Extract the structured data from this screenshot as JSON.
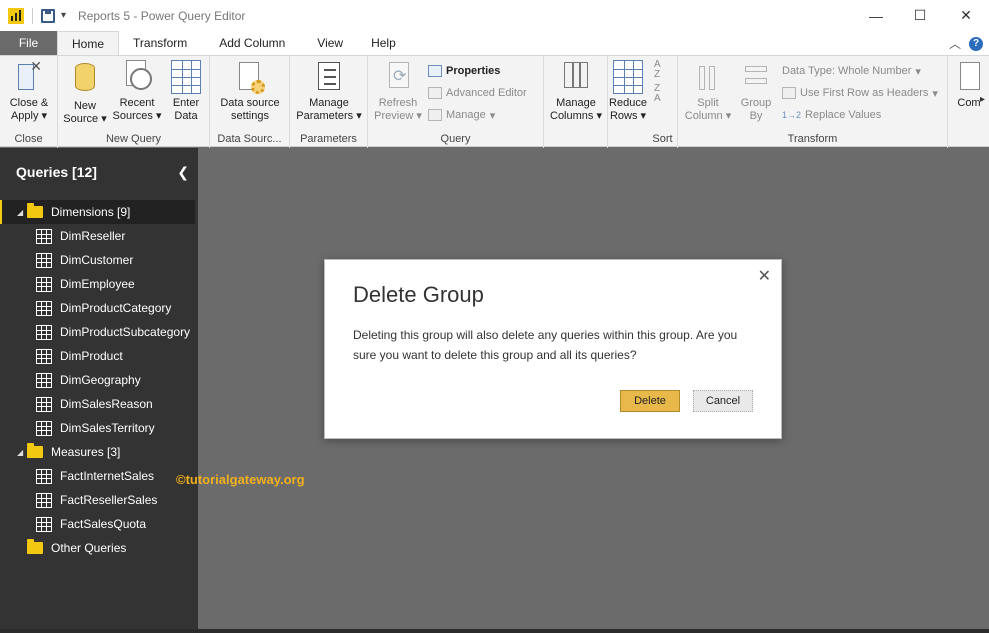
{
  "window": {
    "title": "Reports 5 - Power Query Editor",
    "controls": {
      "minimize": "—",
      "maximize": "☐",
      "close": "✕"
    }
  },
  "tabs": [
    "File",
    "Home",
    "Transform",
    "Add Column",
    "View",
    "Help"
  ],
  "ribbon": {
    "close_group": {
      "label": "Close",
      "close_apply": "Close &\nApply",
      "close_apply_line1": "Close &",
      "close_apply_line2": "Apply"
    },
    "new_query_group": {
      "label": "New Query",
      "new_source_1": "New",
      "new_source_2": "Source",
      "recent_sources_1": "Recent",
      "recent_sources_2": "Sources",
      "enter_data_1": "Enter",
      "enter_data_2": "Data"
    },
    "data_sources_group": {
      "label": "Data Sourc...",
      "btn_1": "Data source",
      "btn_2": "settings"
    },
    "parameters_group": {
      "label": "Parameters",
      "btn_1": "Manage",
      "btn_2": "Parameters"
    },
    "query_group": {
      "label": "Query",
      "refresh_1": "Refresh",
      "refresh_2": "Preview",
      "properties": "Properties",
      "advanced_editor": "Advanced Editor",
      "manage": "Manage"
    },
    "manage_columns_group": {
      "manage_columns_1": "Manage",
      "manage_columns_2": "Columns",
      "reduce_rows_1": "Reduce",
      "reduce_rows_2": "Rows"
    },
    "sort_group": {
      "label": "Sort"
    },
    "transform_group": {
      "label": "Transform",
      "split_1": "Split",
      "split_2": "Column",
      "group_1": "Group",
      "group_2": "By",
      "data_type": "Data Type: Whole Number",
      "first_row": "Use First Row as Headers",
      "replace": "Replace Values"
    },
    "combine": "Com"
  },
  "queries_pane": {
    "title": "Queries [12]",
    "groups": [
      {
        "name": "Dimensions [9]",
        "items": [
          "DimReseller",
          "DimCustomer",
          "DimEmployee",
          "DimProductCategory",
          "DimProductSubcategory",
          "DimProduct",
          "DimGeography",
          "DimSalesReason",
          "DimSalesTerritory"
        ]
      },
      {
        "name": "Measures [3]",
        "items": [
          "FactInternetSales",
          "FactResellerSales",
          "FactSalesQuota"
        ]
      },
      {
        "name": "Other Queries",
        "items": []
      }
    ]
  },
  "watermark": "©tutorialgateway.org",
  "dialog": {
    "title": "Delete Group",
    "message": "Deleting this group will also delete any queries within this group. Are you sure you want to delete this group and all its queries?",
    "delete_label": "Delete",
    "cancel_label": "Cancel"
  },
  "colors": {
    "accent": "#f2c811",
    "pane_bg": "#333333",
    "main_bg": "#6b6b6b"
  }
}
